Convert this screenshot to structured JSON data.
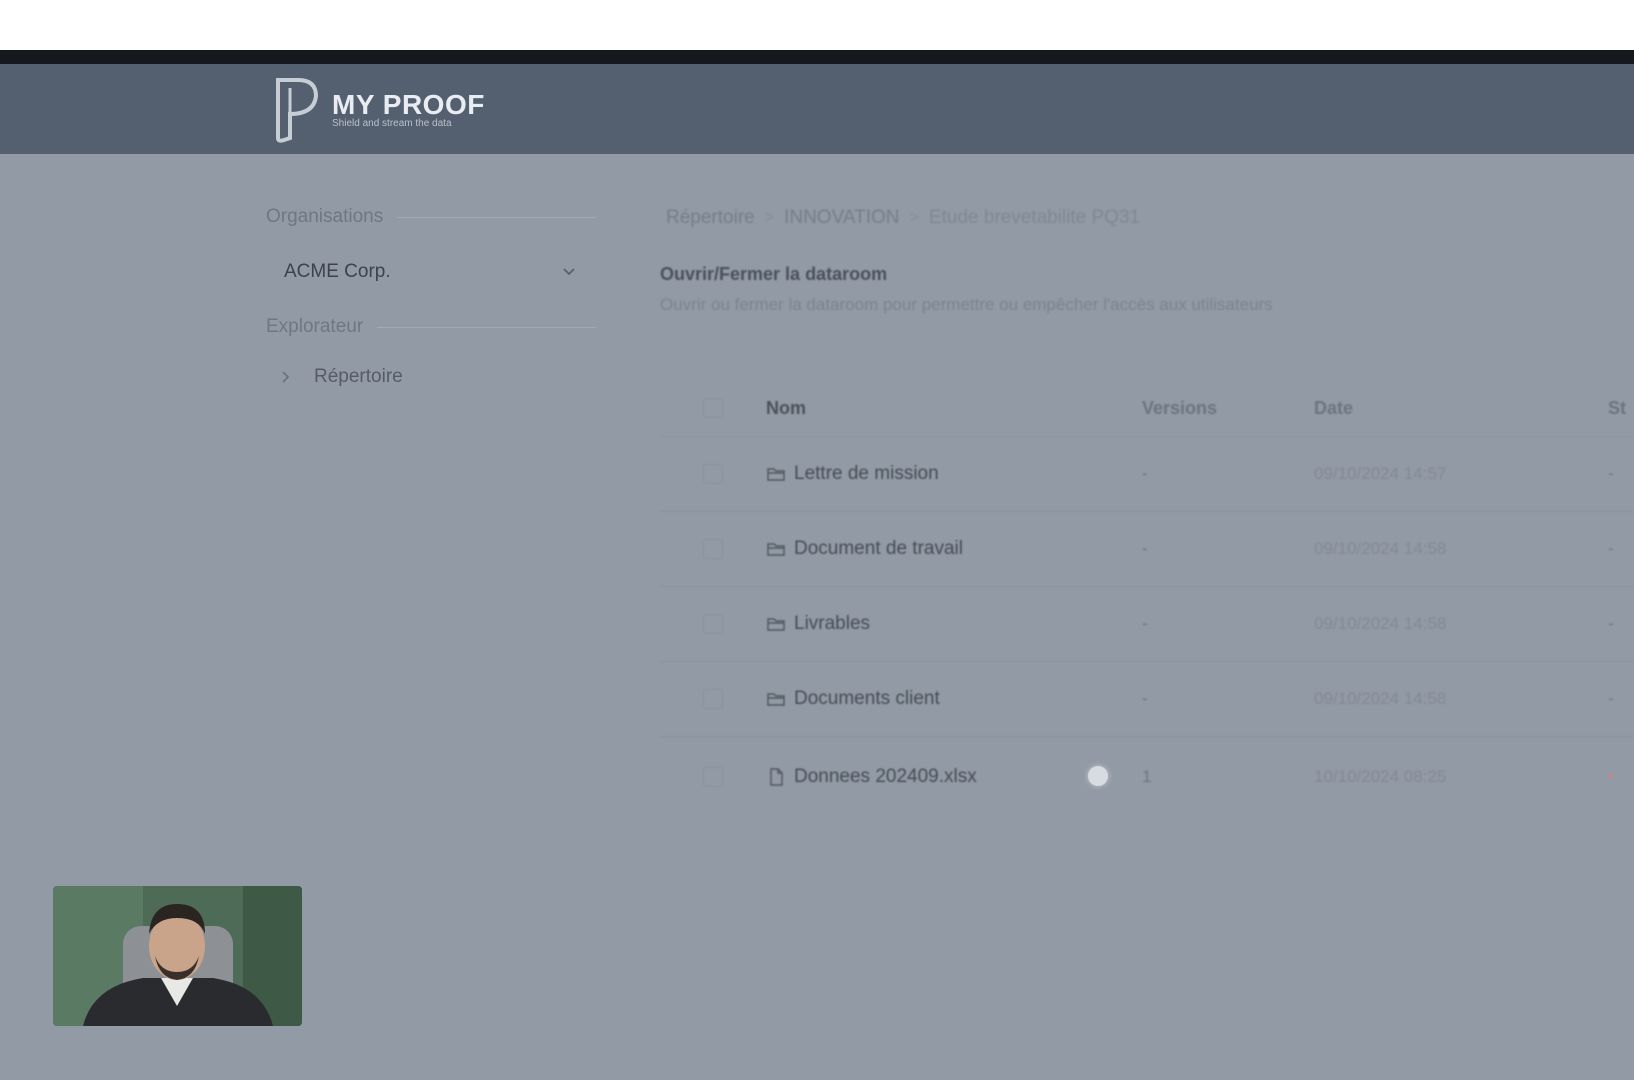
{
  "app": {
    "name": "MY PROOF",
    "tagline": "Shield and stream the data"
  },
  "sidebar": {
    "organisations_title": "Organisations",
    "org_selected": "ACME Corp.",
    "explorer_title": "Explorateur",
    "tree_items": [
      {
        "label": "Répertoire"
      }
    ]
  },
  "breadcrumb": [
    "Répertoire",
    "INNOVATION",
    "Etude brevetabilite PQ31"
  ],
  "dataroom": {
    "title": "Ouvrir/Fermer la dataroom",
    "description": "Ouvrir ou fermer la dataroom pour permettre ou empêcher l'accès aux utilisateurs"
  },
  "table": {
    "headers": {
      "name": "Nom",
      "versions": "Versions",
      "date": "Date",
      "extra": "St"
    },
    "rows": [
      {
        "type": "folder",
        "name": "Lettre de mission",
        "versions": "-",
        "date": "09/10/2024 14:57",
        "extra": "-"
      },
      {
        "type": "folder",
        "name": "Document de travail",
        "versions": "-",
        "date": "09/10/2024 14:58",
        "extra": "-"
      },
      {
        "type": "folder",
        "name": "Livrables",
        "versions": "-",
        "date": "09/10/2024 14:58",
        "extra": "-"
      },
      {
        "type": "folder",
        "name": "Documents client",
        "versions": "-",
        "date": "09/10/2024 14:58",
        "extra": "-"
      },
      {
        "type": "file",
        "name": "Donnees 202409.xlsx",
        "versions": "1",
        "date": "10/10/2024 08:25",
        "extra": "•"
      }
    ]
  },
  "icons": {
    "folder": "folder-icon",
    "file": "file-icon",
    "chevron_down": "chevron-down-icon",
    "chevron_right": "chevron-right-icon"
  },
  "colors": {
    "header_bg": "#54606f",
    "overlay_bg": "#929aa5",
    "status_extra": "#c9848c"
  }
}
